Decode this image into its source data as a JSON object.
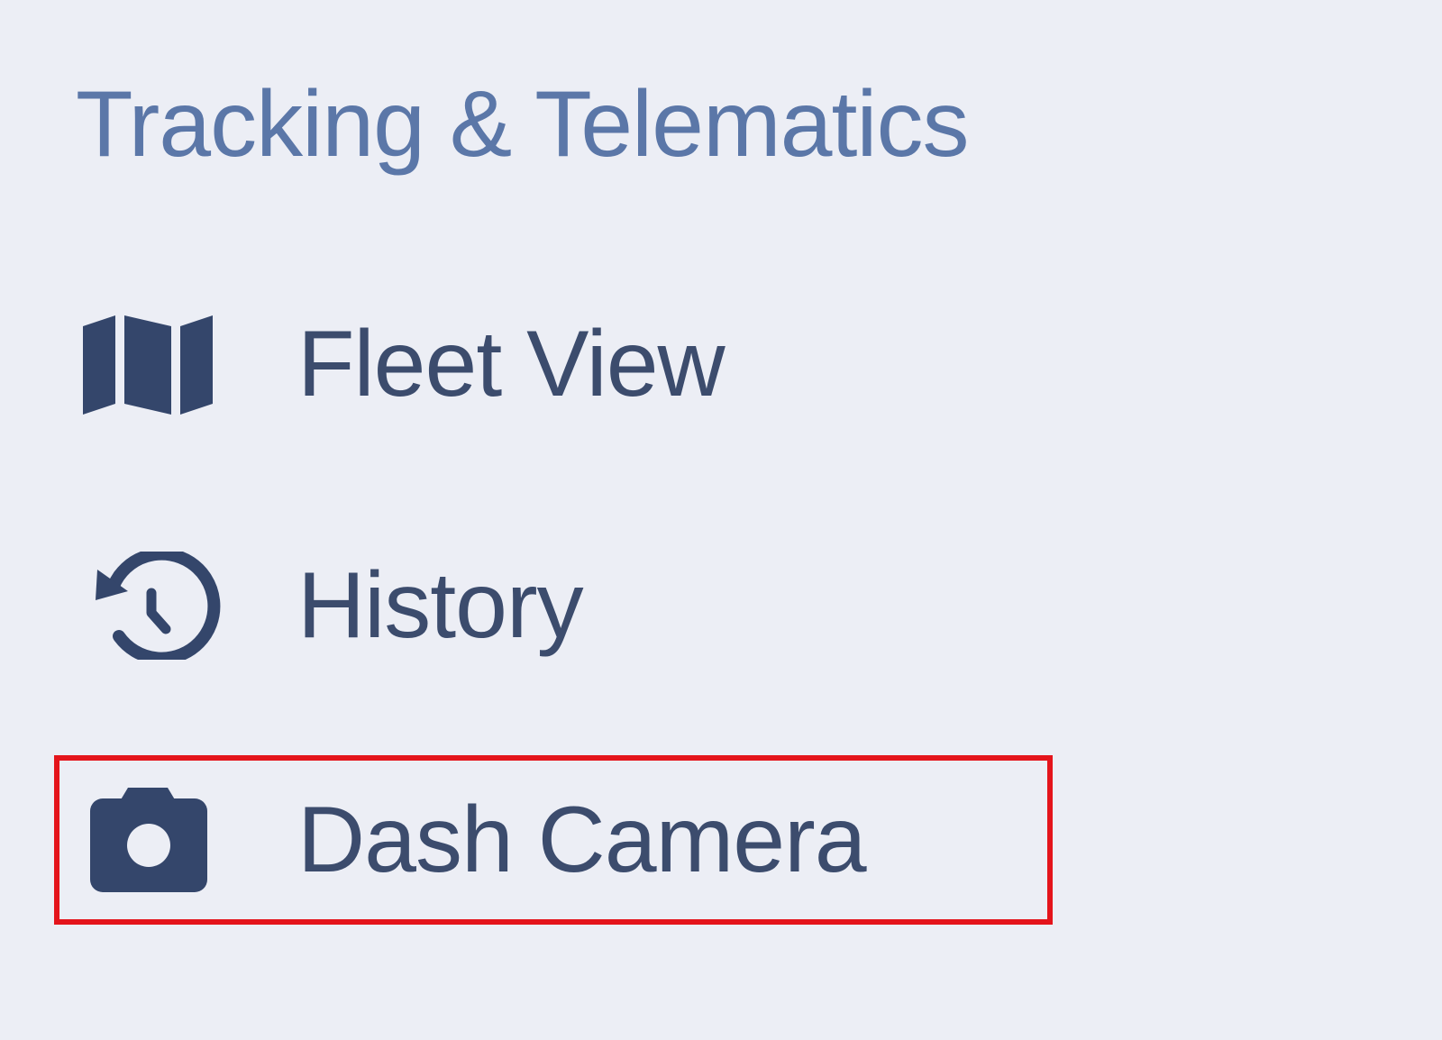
{
  "colors": {
    "background": "#eceef5",
    "section_title": "#5b77a8",
    "item_text": "#3c4c6d",
    "icon": "#34466b",
    "highlight_border": "#e4141b"
  },
  "section": {
    "title": "Tracking & Telematics"
  },
  "nav": {
    "items": [
      {
        "label": "Fleet View",
        "icon": "map-icon"
      },
      {
        "label": "History",
        "icon": "history-icon"
      },
      {
        "label": "Dash Camera",
        "icon": "camera-icon",
        "highlighted": true
      }
    ]
  }
}
